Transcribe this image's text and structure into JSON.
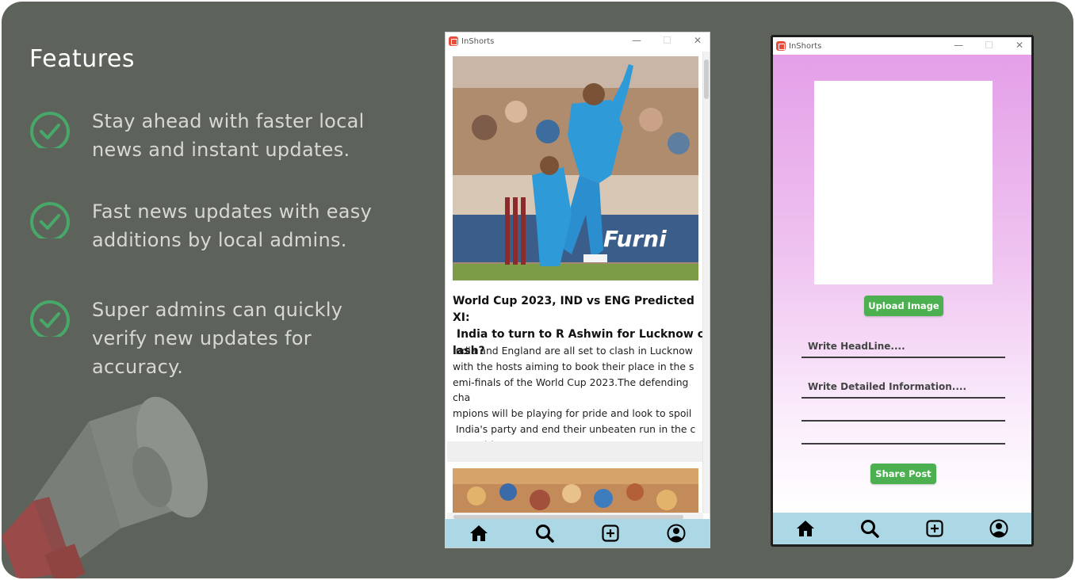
{
  "features": {
    "title": "Features",
    "items": [
      {
        "line1": "Stay ahead with faster local",
        "line2": "news and instant updates.",
        "line3": ""
      },
      {
        "line1": "Fast news updates with easy",
        "line2": "additions by local admins.",
        "line3": ""
      },
      {
        "line1": "Super admins can quickly",
        "line2": "verify new updates for",
        "line3": "accuracy."
      }
    ]
  },
  "colors": {
    "background": "#5d625b",
    "check": "#47a868",
    "navbar": "#acd8e6",
    "button": "#4cb050"
  },
  "left_window": {
    "title": "InShorts",
    "controls": {
      "minimize": "—",
      "maximize": "☐",
      "close": "✕"
    },
    "article": {
      "headline_lines": [
        "World Cup 2023, IND vs ENG Predicted XI:",
        " India to turn to R Ashwin for Lucknow c",
        "lash?"
      ],
      "body_lines": [
        "India and England are all set to clash in Lucknow",
        "with the hosts aiming to book their place in the s",
        "emi-finals of the World Cup 2023.The defending cha",
        "mpions will be playing for pride and look to spoil",
        " India's party and end their unbeaten run in the c",
        "ompetition."
      ],
      "image_icon": "cricket-photo"
    },
    "nav": [
      "home-icon",
      "search-icon",
      "add-post-icon",
      "profile-icon"
    ]
  },
  "right_window": {
    "title": "InShorts",
    "controls": {
      "minimize": "—",
      "maximize": "☐",
      "close": "✕"
    },
    "upload_button": "Upload Image",
    "headline_placeholder": "Write HeadLine....",
    "details_placeholder": "Write Detailed Information....",
    "share_button": "Share Post",
    "nav": [
      "home-icon",
      "search-icon",
      "add-post-icon",
      "profile-icon"
    ]
  }
}
